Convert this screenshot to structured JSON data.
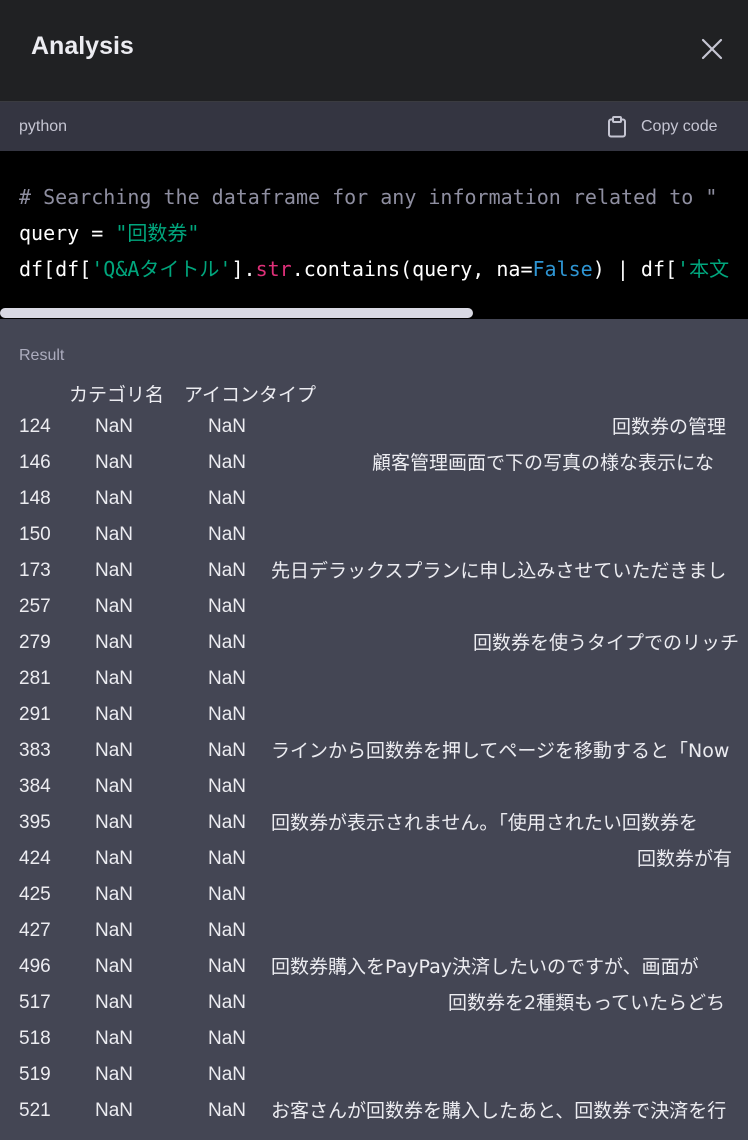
{
  "header": {
    "title": "Analysis"
  },
  "codebar": {
    "language": "python",
    "copy_label": "Copy code"
  },
  "code": {
    "line1_comment": "# Searching the dataframe for any information related to \"",
    "line2_var": "query = ",
    "line2_str": "\"回数券\"",
    "line3_a": "df[df[",
    "line3_str1": "'Q&Aタイトル'",
    "line3_b": "].",
    "line3_attr": "str",
    "line3_c": ".contains(query, na=",
    "line3_kw": "False",
    "line3_d": ") | df[",
    "line3_str2": "'本文"
  },
  "result": {
    "label": "Result",
    "columns": [
      "カテゴリ名",
      "アイコンタイプ"
    ],
    "rows": [
      {
        "index": "124",
        "cat": "NaN",
        "icon": "NaN",
        "text": "回数券の管理"
      },
      {
        "index": "146",
        "cat": "NaN",
        "icon": "NaN",
        "text": "顧客管理画面で下の写真の様な表示にな"
      },
      {
        "index": "148",
        "cat": "NaN",
        "icon": "NaN",
        "text": ""
      },
      {
        "index": "150",
        "cat": "NaN",
        "icon": "NaN",
        "text": ""
      },
      {
        "index": "173",
        "cat": "NaN",
        "icon": "NaN",
        "text": "先日デラックスプランに申し込みさせていただきまし"
      },
      {
        "index": "257",
        "cat": "NaN",
        "icon": "NaN",
        "text": ""
      },
      {
        "index": "279",
        "cat": "NaN",
        "icon": "NaN",
        "text": "回数券を使うタイプでのリッチ"
      },
      {
        "index": "281",
        "cat": "NaN",
        "icon": "NaN",
        "text": ""
      },
      {
        "index": "291",
        "cat": "NaN",
        "icon": "NaN",
        "text": ""
      },
      {
        "index": "383",
        "cat": "NaN",
        "icon": "NaN",
        "text": "ラインから回数券を押してページを移動すると「Now"
      },
      {
        "index": "384",
        "cat": "NaN",
        "icon": "NaN",
        "text": ""
      },
      {
        "index": "395",
        "cat": "NaN",
        "icon": "NaN",
        "text": "回数券が表示されません。「使用されたい回数券を"
      },
      {
        "index": "424",
        "cat": "NaN",
        "icon": "NaN",
        "text": "回数券が有"
      },
      {
        "index": "425",
        "cat": "NaN",
        "icon": "NaN",
        "text": ""
      },
      {
        "index": "427",
        "cat": "NaN",
        "icon": "NaN",
        "text": ""
      },
      {
        "index": "496",
        "cat": "NaN",
        "icon": "NaN",
        "text": "回数券購入をPayPay決済したいのですが、画面が"
      },
      {
        "index": "517",
        "cat": "NaN",
        "icon": "NaN",
        "text": "回数券を2種類もっていたらどち"
      },
      {
        "index": "518",
        "cat": "NaN",
        "icon": "NaN",
        "text": ""
      },
      {
        "index": "519",
        "cat": "NaN",
        "icon": "NaN",
        "text": ""
      },
      {
        "index": "521",
        "cat": "NaN",
        "icon": "NaN",
        "text": "お客さんが回数券を購入したあと、回数券で決済を行"
      }
    ]
  }
}
